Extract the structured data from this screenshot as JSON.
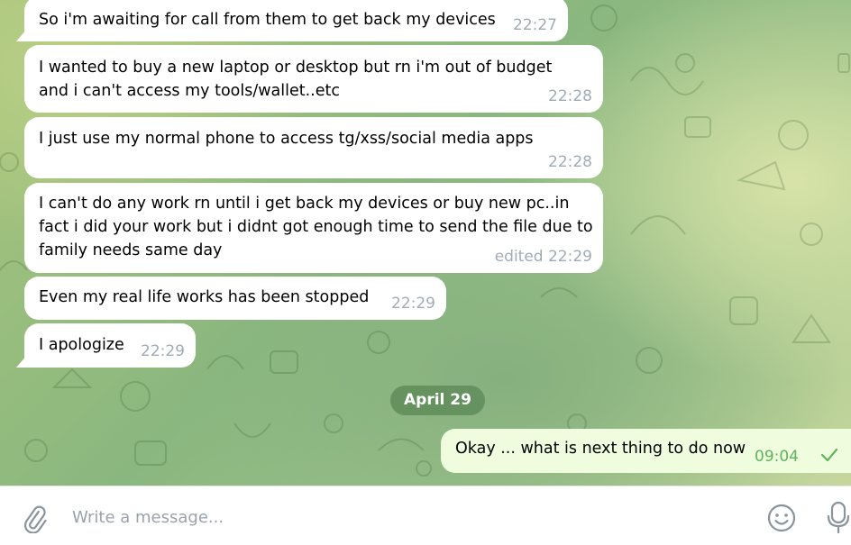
{
  "messages": [
    {
      "text": "So i'm awaiting for call from them to get back my devices",
      "time": "22:27"
    },
    {
      "text": "I wanted to buy a new laptop or desktop but rn i'm out of budget and i can't access my tools/wallet..etc",
      "time": "22:28"
    },
    {
      "text": "I just use my normal phone to access tg/xss/social media apps",
      "time": "22:28"
    },
    {
      "text": "I can't do any work rn until i get back my devices or buy new pc..in fact i did your work but i didnt got enough time to send the file due to family needs same day",
      "time": "edited 22:29"
    },
    {
      "text": "Even my real life works has been stopped",
      "time": "22:29"
    },
    {
      "text": "I apologize",
      "time": "22:29"
    }
  ],
  "date_separator": "April 29",
  "outgoing": {
    "text": "Okay ... what is next thing to do now",
    "time": "09:04",
    "status": "read-check"
  },
  "composer": {
    "placeholder": "Write a message..."
  },
  "icons": [
    "attach-icon",
    "emoji-icon",
    "microphone-icon",
    "check-icon"
  ],
  "colors": {
    "incoming_bg": "#ffffff",
    "outgoing_bg": "#effdde",
    "time_color": "#a0acb6",
    "accent_green": "#5fb35a"
  }
}
